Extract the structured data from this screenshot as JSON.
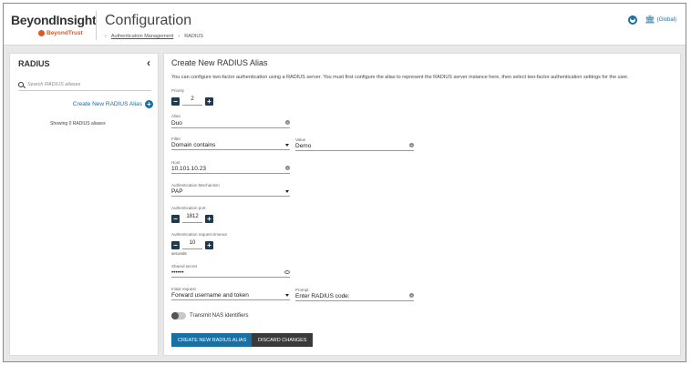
{
  "header": {
    "brand_name": "BeyondInsight",
    "brand_sub": "BeyondTrust",
    "title": "Configuration",
    "breadcrumb": [
      "Authentication Management",
      "RADIUS"
    ],
    "breadcrumb_sep": "›",
    "org_label": "(Global)"
  },
  "sidebar": {
    "title": "RADIUS",
    "search_placeholder": "Search RADIUS aliases",
    "create_label": "Create New RADIUS Alias",
    "count_text": "Showing 0 RADIUS aliases"
  },
  "form": {
    "title": "Create New RADIUS Alias",
    "description": "You can configure two-factor authentication using a RADIUS server. You must first configure the alias to represent the RADIUS server instance here, then select two-factor authentication settings for the user.",
    "priority": {
      "label": "Priority",
      "value": "2"
    },
    "alias": {
      "label": "Alias",
      "value": "Duo"
    },
    "filter": {
      "label": "Filter",
      "value": "Domain contains"
    },
    "filter_value": {
      "label": "Value",
      "value": "Demo"
    },
    "host": {
      "label": "Host",
      "value": "10.101.10.23"
    },
    "auth_mechanism": {
      "label": "Authentication Mechanism",
      "value": "PAP"
    },
    "auth_port": {
      "label": "Authentication port",
      "value": "1812"
    },
    "auth_timeout": {
      "label": "Authentication request timeout",
      "value": "10",
      "unit": "seconds"
    },
    "shared_secret": {
      "label": "Shared secret",
      "value": "••••••"
    },
    "initial_request": {
      "label": "Initial request",
      "value": "Forward username and token"
    },
    "prompt": {
      "label": "Prompt",
      "value": "Enter RADIUS code:"
    },
    "transmit_nas": {
      "label": "Transmit NAS identifiers",
      "on": false
    },
    "create_button": "CREATE NEW RADIUS ALIAS",
    "discard_button": "DISCARD CHANGES",
    "minus_glyph": "−",
    "plus_glyph": "+",
    "clear_glyph": "×"
  },
  "colors": {
    "accent": "#1a6fa3",
    "brand_orange": "#e05a1c",
    "stepper": "#1e3a4f"
  }
}
